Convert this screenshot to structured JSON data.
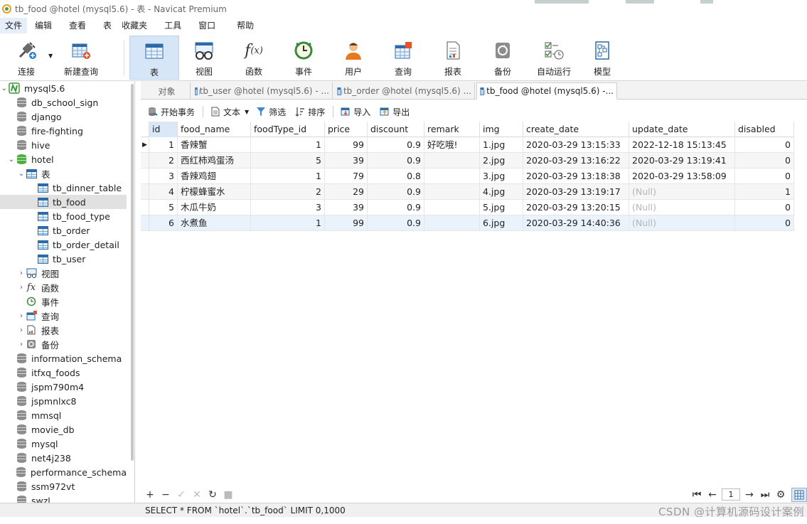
{
  "window": {
    "title": "tb_food @hotel (mysql5.6) - 表 - Navicat Premium"
  },
  "menu": [
    "文件",
    "编辑",
    "查看",
    "表",
    "收藏夹",
    "工具",
    "窗口",
    "帮助"
  ],
  "toolbar": {
    "buttons": [
      {
        "label": "连接",
        "icon": "connection-plug-icon"
      },
      {
        "label": "新建查询",
        "icon": "new-query-icon"
      },
      {
        "label": "表",
        "icon": "table-icon"
      },
      {
        "label": "视图",
        "icon": "view-glasses-icon"
      },
      {
        "label": "函数",
        "icon": "function-fx-icon"
      },
      {
        "label": "事件",
        "icon": "event-clock-icon"
      },
      {
        "label": "用户",
        "icon": "user-icon"
      },
      {
        "label": "查询",
        "icon": "query-icon"
      },
      {
        "label": "报表",
        "icon": "report-icon"
      },
      {
        "label": "备份",
        "icon": "backup-icon"
      },
      {
        "label": "自动运行",
        "icon": "automation-icon"
      },
      {
        "label": "模型",
        "icon": "model-icon"
      }
    ],
    "selected": "表"
  },
  "sidebar": {
    "connection": "mysql5.6",
    "databases_top": [
      "db_school_sign",
      "django",
      "fire-fighting",
      "hive"
    ],
    "open_db": "hotel",
    "tables_folder": "表",
    "tables": [
      "tb_dinner_table",
      "tb_food",
      "tb_food_type",
      "tb_order",
      "tb_order_detail",
      "tb_user"
    ],
    "selected_table": "tb_food",
    "folders": [
      "视图",
      "函数",
      "事件",
      "查询",
      "报表",
      "备份"
    ],
    "databases_bottom": [
      "information_schema",
      "itfxq_foods",
      "jspm790m4",
      "jspmnlxc8",
      "mmsql",
      "movie_db",
      "mysql",
      "net4j238",
      "performance_schema",
      "ssm972vt",
      "swzl"
    ]
  },
  "tabs": [
    {
      "label": "对象"
    },
    {
      "label": "tb_user @hotel (mysql5.6) - ..."
    },
    {
      "label": "tb_order @hotel (mysql5.6) ..."
    },
    {
      "label": "tb_food @hotel (mysql5.6) -..."
    }
  ],
  "actions": {
    "begin_transaction": "开始事务",
    "text": "文本",
    "filter": "筛选",
    "sort": "排序",
    "import": "导入",
    "export": "导出"
  },
  "grid": {
    "columns": [
      "id",
      "food_name",
      "foodType_id",
      "price",
      "discount",
      "remark",
      "img",
      "create_date",
      "update_date",
      "disabled"
    ],
    "rows": [
      [
        "1",
        "香辣蟹",
        "1",
        "99",
        "0.9",
        "好吃哦!",
        "1.jpg",
        "2020-03-29 13:15:33",
        "2022-12-18 15:13:45",
        "0"
      ],
      [
        "2",
        "西红柿鸡蛋汤",
        "5",
        "39",
        "0.9",
        "",
        "2.jpg",
        "2020-03-29 13:16:22",
        "2020-03-29 13:19:41",
        "0"
      ],
      [
        "3",
        "香辣鸡翅",
        "1",
        "79",
        "0.8",
        "",
        "3.jpg",
        "2020-03-29 13:18:38",
        "2020-03-29 13:58:09",
        "0"
      ],
      [
        "4",
        "柠檬蜂蜜水",
        "2",
        "29",
        "0.9",
        "",
        "4.jpg",
        "2020-03-29 13:19:17",
        "(Null)",
        "1"
      ],
      [
        "5",
        "木瓜牛奶",
        "3",
        "39",
        "0.9",
        "",
        "5.jpg",
        "2020-03-29 13:20:15",
        "(Null)",
        "0"
      ],
      [
        "6",
        "水煮鱼",
        "1",
        "99",
        "0.9",
        "",
        "6.jpg",
        "2020-03-29 14:40:36",
        "(Null)",
        "0"
      ]
    ]
  },
  "pager": {
    "page": "1"
  },
  "status": {
    "sql": "SELECT * FROM `hotel`.`tb_food` LIMIT 0,1000",
    "watermark": "CSDN @计算机源码设计案例"
  }
}
